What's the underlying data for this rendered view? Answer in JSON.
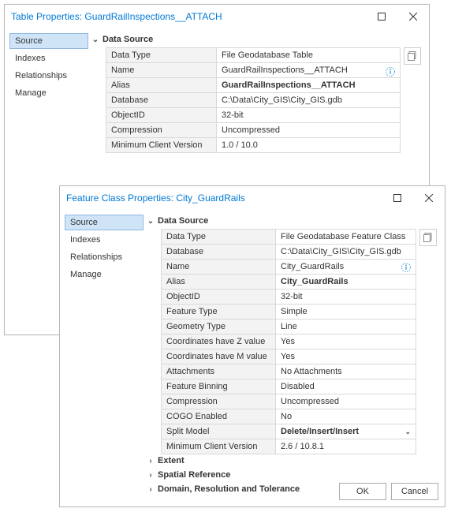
{
  "dialog1": {
    "title": "Table Properties: GuardRailInspections__ATTACH",
    "sidebar": [
      "Source",
      "Indexes",
      "Relationships",
      "Manage"
    ],
    "section": "Data Source",
    "rows": [
      {
        "k": "Data Type",
        "v": "File Geodatabase Table"
      },
      {
        "k": "Name",
        "v": "GuardRailInspections__ATTACH"
      },
      {
        "k": "Alias",
        "v": "GuardRailInspections__ATTACH",
        "bold": true
      },
      {
        "k": "Database",
        "v": "C:\\Data\\City_GIS\\City_GIS.gdb"
      },
      {
        "k": "ObjectID",
        "v": "32-bit"
      },
      {
        "k": "Compression",
        "v": "Uncompressed"
      },
      {
        "k": "Minimum Client Version",
        "v": "1.0 / 10.0"
      }
    ],
    "col1w": 140
  },
  "dialog2": {
    "title": "Feature Class Properties: City_GuardRails",
    "sidebar": [
      "Source",
      "Indexes",
      "Relationships",
      "Manage"
    ],
    "section": "Data Source",
    "rows": [
      {
        "k": "Data Type",
        "v": "File Geodatabase Feature Class"
      },
      {
        "k": "Database",
        "v": "C:\\Data\\City_GIS\\City_GIS.gdb"
      },
      {
        "k": "Name",
        "v": "City_GuardRails"
      },
      {
        "k": "Alias",
        "v": "City_GuardRails",
        "bold": true
      },
      {
        "k": "ObjectID",
        "v": "32-bit"
      },
      {
        "k": "Feature Type",
        "v": "Simple"
      },
      {
        "k": "Geometry Type",
        "v": "Line"
      },
      {
        "k": "Coordinates have Z value",
        "v": "Yes"
      },
      {
        "k": "Coordinates have M value",
        "v": "Yes"
      },
      {
        "k": "Attachments",
        "v": "No Attachments"
      },
      {
        "k": "Feature Binning",
        "v": "Disabled"
      },
      {
        "k": "Compression",
        "v": "Uncompressed"
      },
      {
        "k": "COGO Enabled",
        "v": "No"
      },
      {
        "k": "Split Model",
        "v": "Delete/Insert/Insert",
        "select": true,
        "bold": true
      },
      {
        "k": "Minimum Client Version",
        "v": "2.6 / 10.8.1"
      }
    ],
    "col1w": 145,
    "extraSections": [
      "Extent",
      "Spatial Reference",
      "Domain, Resolution and Tolerance"
    ],
    "ok": "OK",
    "cancel": "Cancel"
  }
}
